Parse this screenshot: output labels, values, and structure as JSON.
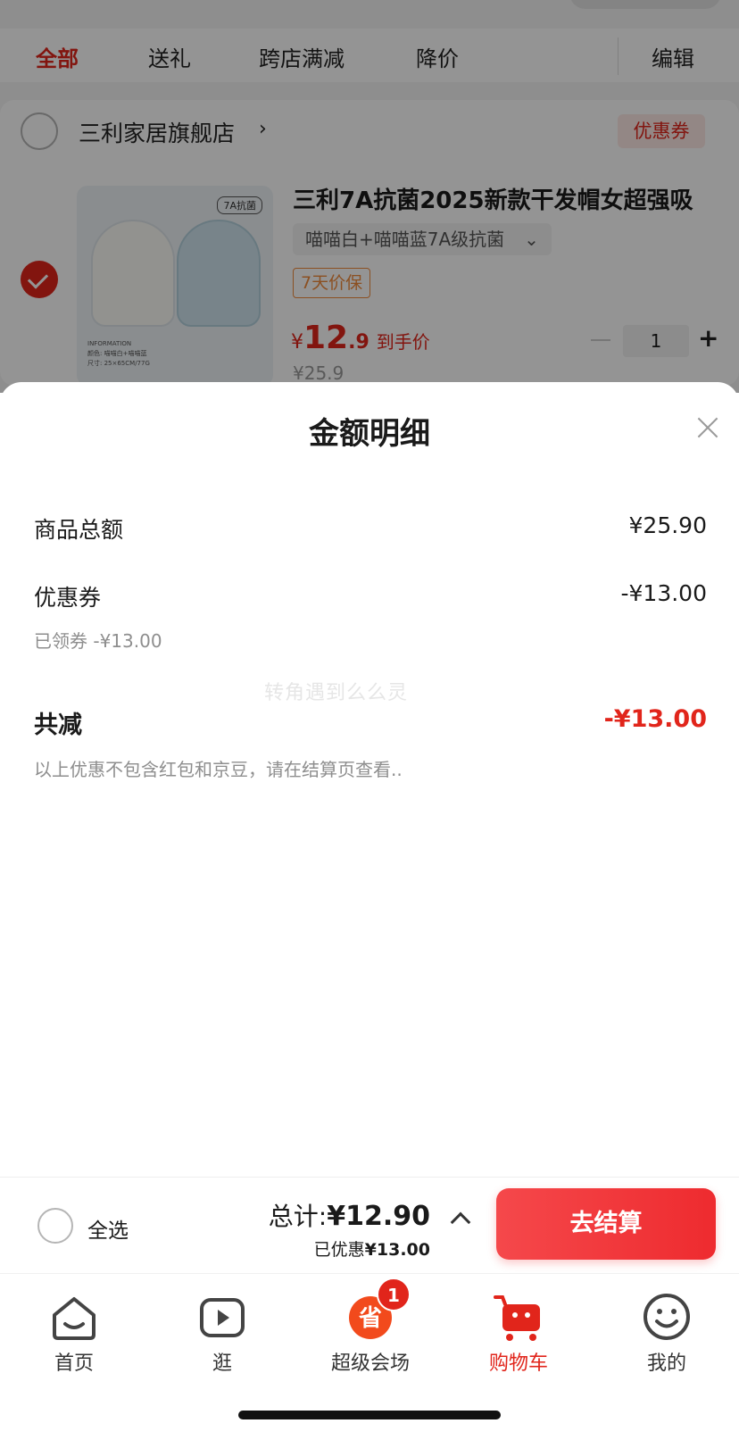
{
  "filter_tabs": [
    "全部",
    "送礼",
    "跨店满减",
    "降价"
  ],
  "edit_label": "编辑",
  "shop": {
    "name": "三利家居旗舰店",
    "chevron": "›",
    "coupon_label": "优惠券"
  },
  "product": {
    "image_tag": "7A抗菌",
    "image_info": [
      "INFORMATION",
      "颜色: 喵喵白+喵喵蓝",
      "尺寸: 25×65CM/77G"
    ],
    "title": "三利7A抗菌2025新款干发帽女超强吸",
    "spec": "喵喵白+喵喵蓝7A级抗菌",
    "spec_chevron": "⌄",
    "price_tag": "7天价保",
    "price_currency": "¥",
    "price_int": "12",
    "price_dec": ".9",
    "price_label": "到手价",
    "old_price": "¥25.9",
    "quantity": "1",
    "qty_plus": "+"
  },
  "sheet": {
    "title": "金额明细",
    "rows": [
      {
        "label": "商品总额",
        "value": "¥25.90"
      },
      {
        "label": "优惠券",
        "value": "-¥13.00",
        "sub": "已领券 -¥13.00"
      }
    ],
    "watermark": "转角遇到么么灵",
    "total_reduction_label": "共减",
    "total_reduction_value": "-¥13.00",
    "note": "以上优惠不包含红包和京豆，请在结算页查看.."
  },
  "checkout": {
    "select_all": "全选",
    "total_label": "总计:",
    "total_amount": "¥12.90",
    "saved_label": "已优惠",
    "saved_amount": "¥13.00",
    "button": "去结算"
  },
  "tabbar": {
    "items": [
      {
        "label": "首页",
        "icon": "home-icon"
      },
      {
        "label": "逛",
        "icon": "video-icon"
      },
      {
        "label": "超级会场",
        "icon": "super-venue-icon",
        "badge": "1",
        "glyph": "省"
      },
      {
        "label": "购物车",
        "icon": "cart-icon"
      },
      {
        "label": "我的",
        "icon": "smiley-icon"
      }
    ],
    "active_index": 3
  },
  "colors": {
    "accent": "#e1251b",
    "orange_tag": "#f08a3c"
  }
}
